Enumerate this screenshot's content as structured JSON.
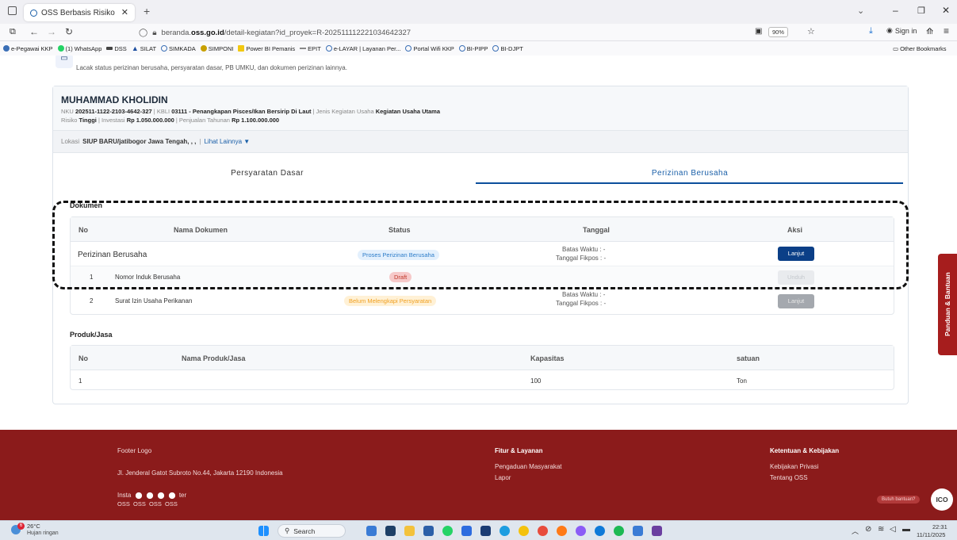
{
  "browser": {
    "tab_title": "OSS Berbasis Risiko",
    "new_tab": "+",
    "url_prefix": "beranda.",
    "url_domain": "oss.go.id",
    "url_path": "/detail-kegiatan?id_proyek=R-202511112221034642327",
    "zoom": "90%",
    "sign_in": "Sign in",
    "other_bookmarks": "Other Bookmarks"
  },
  "bookmarks": [
    {
      "label": "e-Pegawai KKP",
      "color": "#3b6fb6"
    },
    {
      "label": "(1) WhatsApp",
      "color": "#25d366"
    },
    {
      "label": "DSS",
      "color": "#444444"
    },
    {
      "label": "SILAT",
      "color": "#1e4fa0"
    },
    {
      "label": "SIMKADA",
      "color": "#3b6fb6"
    },
    {
      "label": "SIMPONI",
      "color": "#c8a000"
    },
    {
      "label": "Power BI Pemanis",
      "color": "#f2c811"
    },
    {
      "label": "EPIT",
      "color": "#888888"
    },
    {
      "label": "e-LAYAR | Layanan Per...",
      "color": "#3b6fb6"
    },
    {
      "label": "Portal Wifi KKP",
      "color": "#3b6fb6"
    },
    {
      "label": "BI-PIPP",
      "color": "#3b6fb6"
    },
    {
      "label": "BI-DJPT",
      "color": "#3b6fb6"
    }
  ],
  "page": {
    "intro": "Lacak status perizinan berusaha, persyaratan dasar, PB UMKU, dan dokumen perizinan lainnya.",
    "name": "MUHAMMAD KHOLIDIN",
    "nku_label": "NKU",
    "nku": "202511-1122-2103-4642-327",
    "kbli_label": "KBLI",
    "kbli": "03111 - Penangkapan Pisces/Ikan Bersirip Di Laut",
    "jenis_label": "Jenis Kegiatan Usaha",
    "jenis": "Kegiatan Usaha Utama",
    "risiko_label": "Risiko",
    "risiko": "Tinggi",
    "investasi_label": "Investasi",
    "investasi": "Rp 1.050.000.000",
    "penjualan_label": "Penjualan Tahunan",
    "penjualan": "Rp 1.100.000.000",
    "lokasi_label": "Lokasi",
    "lokasi": "SIUP BARU/jatibogor Jawa Tengah, , ,",
    "lihat": "Lihat Lainnya ▼",
    "tabs": [
      "Persyaratan Dasar",
      "Perizinan Berusaha"
    ]
  },
  "dokumen": {
    "title": "Dokumen",
    "headers": [
      "No",
      "Nama Dokumen",
      "Status",
      "Tanggal",
      "Aksi"
    ],
    "group": {
      "name": "Perizinan Berusaha",
      "status": "Proses Perizinan Berusaha",
      "batas": "Batas Waktu : -",
      "fikpos": "Tanggal Fikpos : -",
      "action": "Lanjut"
    },
    "rows": [
      {
        "no": "1",
        "name": "Nomor Induk Berusaha",
        "status": "Draft",
        "action": "Unduh"
      },
      {
        "no": "2",
        "name": "Surat Izin Usaha Perikanan",
        "status": "Belum Melengkapi Persyaratan",
        "batas": "Batas Waktu : -",
        "fikpos": "Tanggal Fikpos : -",
        "action": "Lanjut"
      }
    ]
  },
  "produk": {
    "title": "Produk/Jasa",
    "headers": [
      "No",
      "Nama Produk/Jasa",
      "Kapasitas",
      "satuan"
    ],
    "rows": [
      {
        "no": "1",
        "name": "",
        "kapasitas": "100",
        "satuan": "Ton"
      }
    ]
  },
  "footer": {
    "logo": "Footer Logo",
    "address": "Jl. Jenderal Gatot Subroto No.44, Jakarta 12190 Indonesia",
    "social_left": "Insta",
    "social_right": "ter",
    "social_labels": "OSS  OSS  OSS  OSS",
    "fitur_title": "Fitur & Layanan",
    "fitur_items": [
      "Pengaduan Masyarakat",
      "Lapor"
    ],
    "ketentuan_title": "Ketentuan & Kebijakan",
    "ketentuan_items": [
      "Kebijakan Privasi",
      "Tentang OSS"
    ],
    "help_pill": "Butuh bantuan?",
    "ico": "ICO",
    "side_tab": "Panduan & Bantuan"
  },
  "taskbar": {
    "weather_temp": "26°C",
    "weather_desc": "Hujan ringan",
    "weather_badge": "6",
    "search": "Search",
    "time": "22:31",
    "date": "11/11/2025"
  }
}
